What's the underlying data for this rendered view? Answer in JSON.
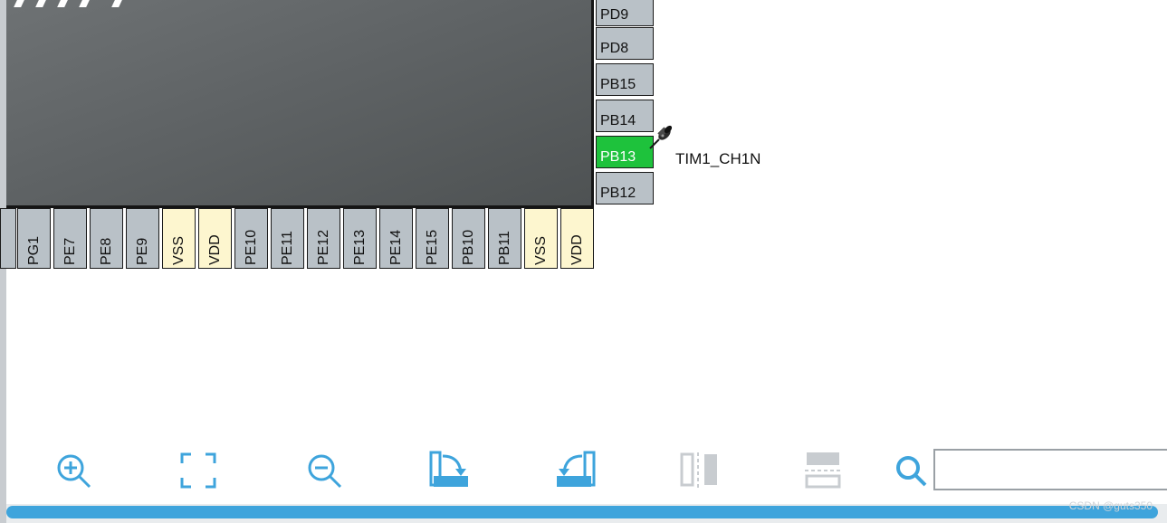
{
  "mcu": {
    "right_pins": [
      {
        "name": "PD9",
        "state": "default"
      },
      {
        "name": "PD8",
        "state": "default"
      },
      {
        "name": "PB15",
        "state": "default"
      },
      {
        "name": "PB14",
        "state": "default"
      },
      {
        "name": "PB13",
        "state": "assigned"
      },
      {
        "name": "PB12",
        "state": "default"
      }
    ],
    "bottom_pins": [
      {
        "name": "PG1",
        "type": "io"
      },
      {
        "name": "PE7",
        "type": "io"
      },
      {
        "name": "PE8",
        "type": "io"
      },
      {
        "name": "PE9",
        "type": "io"
      },
      {
        "name": "VSS",
        "type": "power"
      },
      {
        "name": "VDD",
        "type": "power"
      },
      {
        "name": "PE10",
        "type": "io"
      },
      {
        "name": "PE11",
        "type": "io"
      },
      {
        "name": "PE12",
        "type": "io"
      },
      {
        "name": "PE13",
        "type": "io"
      },
      {
        "name": "PE14",
        "type": "io"
      },
      {
        "name": "PE15",
        "type": "io"
      },
      {
        "name": "PB10",
        "type": "io"
      },
      {
        "name": "PB11",
        "type": "io"
      },
      {
        "name": "VSS",
        "type": "power"
      },
      {
        "name": "VDD",
        "type": "power"
      }
    ],
    "signal_label": "TIM1_CH1N"
  },
  "toolbar": {
    "icons": [
      "zoom-in-icon",
      "fit-to-screen-icon",
      "zoom-out-icon",
      "rotate-clockwise-icon",
      "rotate-counterclockwise-icon",
      "flip-vertical-icon",
      "flip-horizontal-icon"
    ],
    "search_value": ""
  },
  "watermark": "CSDN @guts350",
  "colors": {
    "assigned_pin": "#1ec23c",
    "io_pin": "#b9c1c7",
    "power_pin": "#fdf6cf",
    "accent": "#3ea4dc"
  }
}
